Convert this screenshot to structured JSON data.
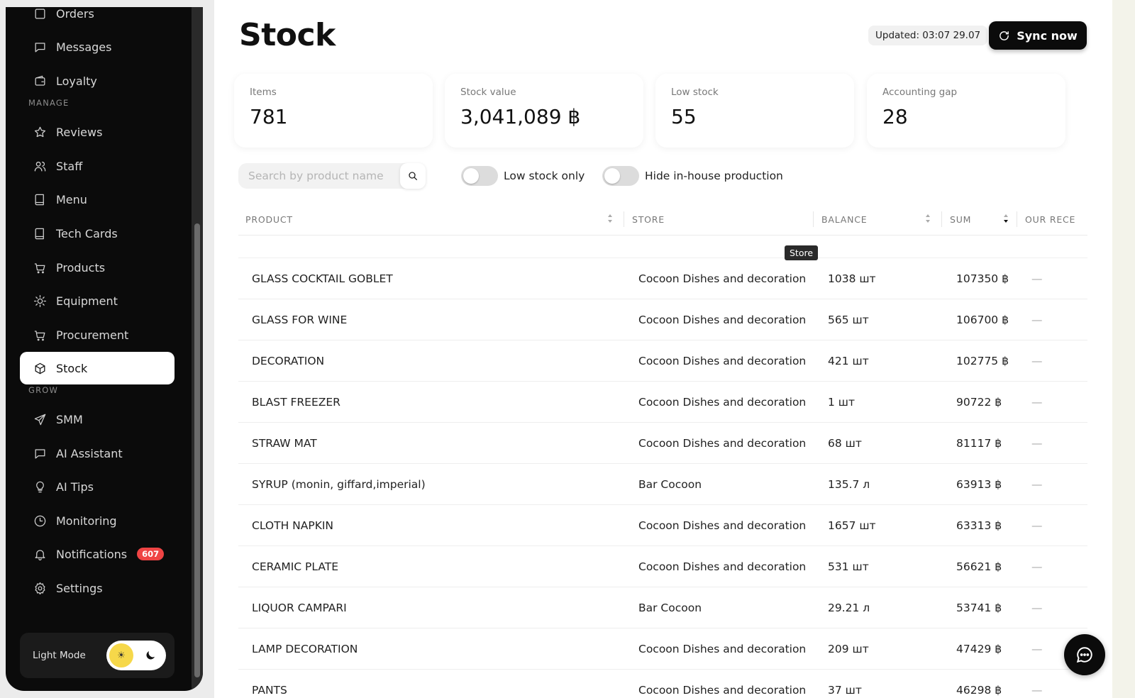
{
  "sidebar": {
    "items": [
      {
        "label": "Orders",
        "icon": "orders-icon"
      },
      {
        "label": "Messages",
        "icon": "message-icon"
      },
      {
        "label": "Loyalty",
        "icon": "wallet-icon"
      },
      {
        "label": "Reviews",
        "icon": "star-icon"
      },
      {
        "label": "Staff",
        "icon": "users-icon"
      },
      {
        "label": "Menu",
        "icon": "book-icon"
      },
      {
        "label": "Tech Cards",
        "icon": "book-icon"
      },
      {
        "label": "Products",
        "icon": "cart-icon"
      },
      {
        "label": "Equipment",
        "icon": "sun-gear-icon"
      },
      {
        "label": "Procurement",
        "icon": "cart-icon"
      },
      {
        "label": "Stock",
        "icon": "box-icon"
      },
      {
        "label": "SMM",
        "icon": "send-icon"
      },
      {
        "label": "AI Assistant",
        "icon": "message-icon"
      },
      {
        "label": "AI Tips",
        "icon": "bulb-icon"
      },
      {
        "label": "Monitoring",
        "icon": "clock-icon"
      },
      {
        "label": "Notifications",
        "icon": "bell-icon",
        "badge": "607"
      },
      {
        "label": "Settings",
        "icon": "gear-icon"
      }
    ],
    "sections": {
      "manage": "MANAGE",
      "grow": "GROW"
    },
    "mode_label": "Light Mode",
    "active": "Stock"
  },
  "header": {
    "title": "Stock",
    "updated": "Updated: 03:07 29.07",
    "sync_label": "Sync now"
  },
  "cards": [
    {
      "label": "Items",
      "value": "781"
    },
    {
      "label": "Stock value",
      "value": "3,041,089 ฿"
    },
    {
      "label": "Low stock",
      "value": "55"
    },
    {
      "label": "Accounting gap",
      "value": "28"
    }
  ],
  "filters": {
    "search_placeholder": "Search by product name",
    "low_stock_label": "Low stock only",
    "hide_inhouse_label": "Hide in-house production",
    "low_stock_on": false,
    "hide_inhouse_on": false
  },
  "table": {
    "columns": [
      "PRODUCT",
      "STORE",
      "BALANCE",
      "SUM",
      "OUR RECE"
    ],
    "tooltip": "Store",
    "rows": [
      {
        "product": "GLASS COCKTAIL GOBLET",
        "store": "Cocoon Dishes and decoration",
        "balance": "1038 шт",
        "sum": "107350 ฿",
        "rec": "—"
      },
      {
        "product": "GLASS FOR WINE",
        "store": "Cocoon Dishes and decoration",
        "balance": "565 шт",
        "sum": "106700 ฿",
        "rec": "—"
      },
      {
        "product": "DECORATION",
        "store": "Cocoon Dishes and decoration",
        "balance": "421 шт",
        "sum": "102775 ฿",
        "rec": "—"
      },
      {
        "product": "BLAST FREEZER",
        "store": "Cocoon Dishes and decoration",
        "balance": "1 шт",
        "sum": "90722 ฿",
        "rec": "—"
      },
      {
        "product": "STRAW MAT",
        "store": "Cocoon Dishes and decoration",
        "balance": "68 шт",
        "sum": "81117 ฿",
        "rec": "—"
      },
      {
        "product": "SYRUP (monin, giffard,imperial)",
        "store": "Bar Cocoon",
        "balance": "135.7 л",
        "sum": "63913 ฿",
        "rec": "—"
      },
      {
        "product": "CLOTH NAPKIN",
        "store": "Cocoon Dishes and decoration",
        "balance": "1657 шт",
        "sum": "63313 ฿",
        "rec": "—"
      },
      {
        "product": "CERAMIC PLATE",
        "store": "Cocoon Dishes and decoration",
        "balance": "531 шт",
        "sum": "56621 ฿",
        "rec": "—"
      },
      {
        "product": "LIQUOR CAMPARI",
        "store": "Bar Cocoon",
        "balance": "29.21 л",
        "sum": "53741 ฿",
        "rec": "—"
      },
      {
        "product": "LAMP DECORATION",
        "store": "Cocoon Dishes and decoration",
        "balance": "209 шт",
        "sum": "47429 ฿",
        "rec": "—"
      },
      {
        "product": "PANTS",
        "store": "Cocoon Dishes and decoration",
        "balance": "37 шт",
        "sum": "46298 ฿",
        "rec": "—"
      }
    ]
  }
}
